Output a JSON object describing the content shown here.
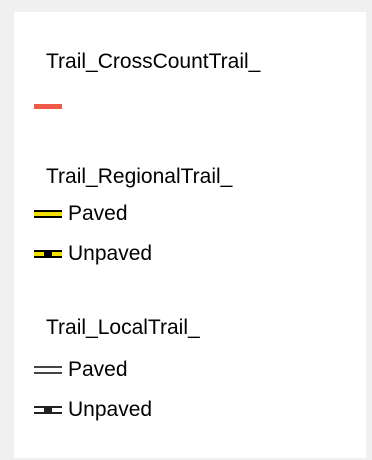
{
  "legend": {
    "groups": [
      {
        "title": "Trail_CrossCountTrail_",
        "items": [
          {
            "label": "",
            "symbol": "solid",
            "color": "#ee5a45"
          }
        ]
      },
      {
        "title": "Trail_RegionalTrail_",
        "items": [
          {
            "label": "Paved",
            "symbol": "double-line",
            "color": "#f2e000",
            "border": "#000000"
          },
          {
            "label": "Unpaved",
            "symbol": "dashed-double-line",
            "color": "#f2e000",
            "border": "#000000"
          }
        ]
      },
      {
        "title": "Trail_LocalTrail_",
        "items": [
          {
            "label": "Paved",
            "symbol": "double-line",
            "color": "#ffffff",
            "border": "#000000"
          },
          {
            "label": "Unpaved",
            "symbol": "dashed-double-line",
            "color": "#ffffff",
            "border": "#000000"
          }
        ]
      }
    ]
  }
}
